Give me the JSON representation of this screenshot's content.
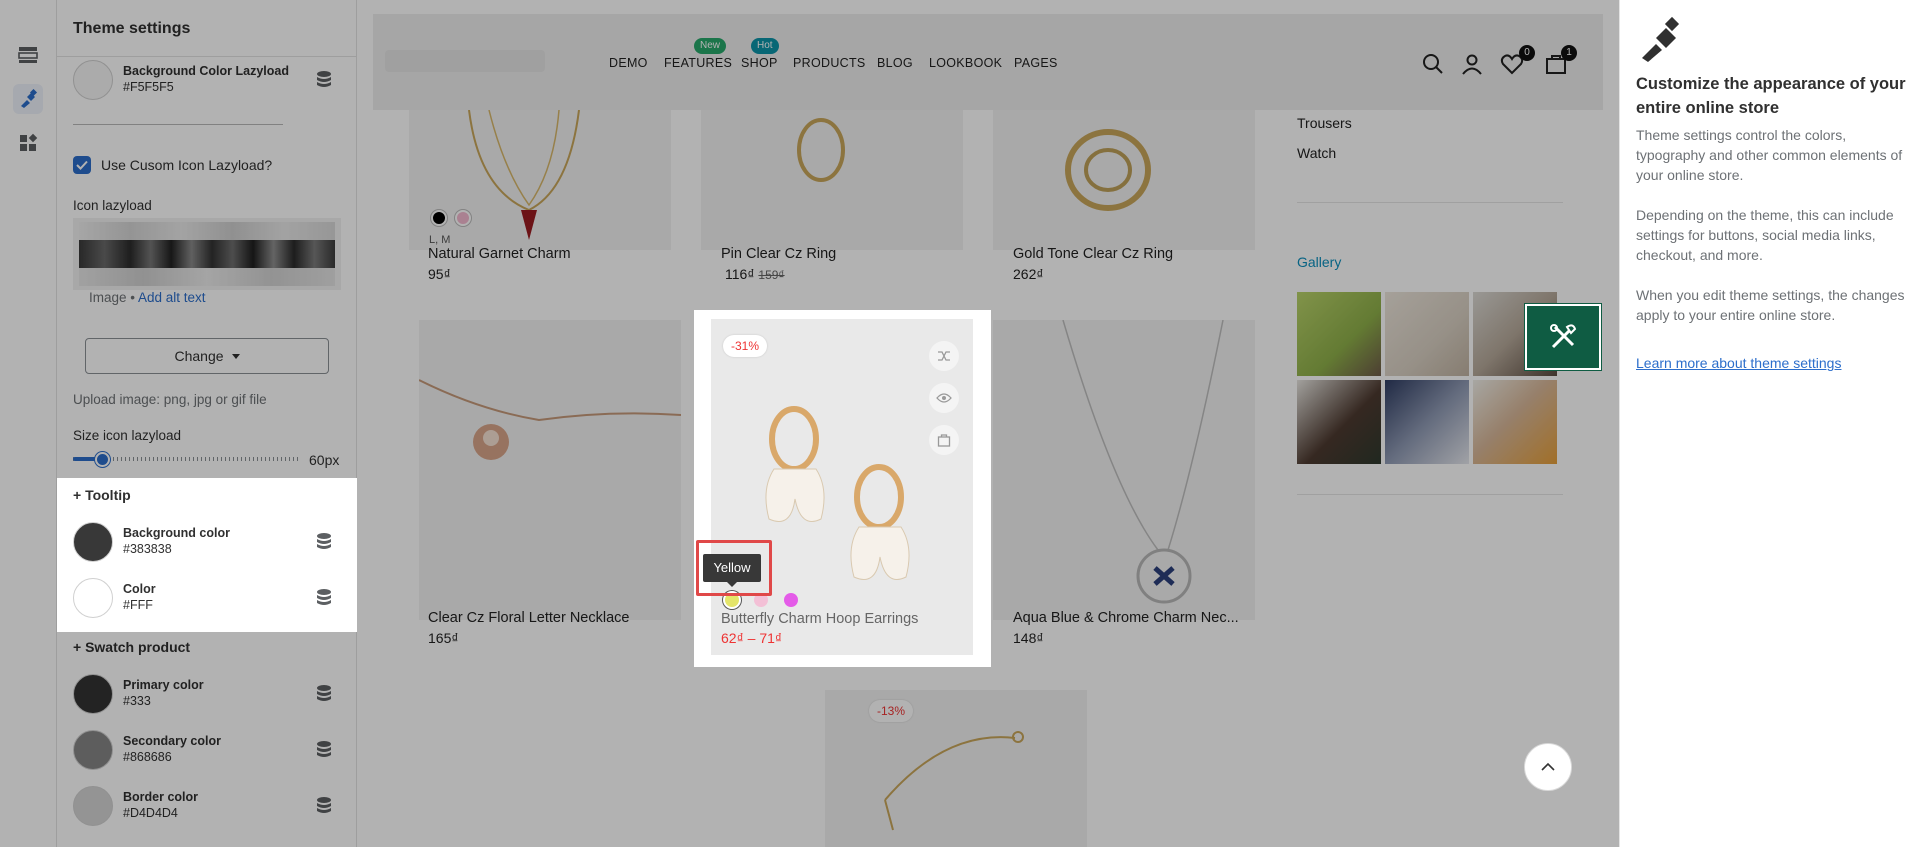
{
  "rail": {
    "items": [
      "sections",
      "theme-settings",
      "apps"
    ]
  },
  "panel": {
    "title": "Theme settings",
    "bg_lazyload": {
      "name": "Background Color Lazyload",
      "value": "#F5F5F5",
      "color": "#F5F5F5"
    },
    "checkbox_label": "Use Cusom Icon Lazyload?",
    "icon_label": "Icon lazyload",
    "image_caption": "Image",
    "alt_link": "Add alt text",
    "change_label": "Change",
    "upload_help": "Upload image: png, jpg or gif file",
    "size_label": "Size icon lazyload",
    "size_value": "60px",
    "size_percent": 8,
    "tooltip_section": "+ Tooltip",
    "tooltip_bg": {
      "name": "Background color",
      "value": "#383838",
      "color": "#383838"
    },
    "tooltip_color": {
      "name": "Color",
      "value": "#FFF",
      "color": "#FFFFFF"
    },
    "swatch_section": "+ Swatch product",
    "primary": {
      "name": "Primary color",
      "value": "#333",
      "color": "#333333"
    },
    "secondary": {
      "name": "Secondary color",
      "value": "#868686",
      "color": "#868686"
    },
    "border": {
      "name": "Border color",
      "value": "#D4D4D4",
      "color": "#D4D4D4"
    }
  },
  "store": {
    "nav": [
      "DEMO",
      "FEATURES",
      "SHOP",
      "PRODUCTS",
      "BLOG",
      "LOOKBOOK",
      "PAGES"
    ],
    "badge_new": "New",
    "badge_hot": "Hot",
    "wishlist_count": "0",
    "cart_count": "1",
    "products": [
      {
        "title": "Natural Garnet Charm",
        "price": "95₫",
        "sizes": "L, M"
      },
      {
        "title": "Pin Clear Cz Ring",
        "price": "116₫",
        "old_price": "159₫"
      },
      {
        "title": "Gold Tone Clear Cz Ring",
        "price": "262₫"
      },
      {
        "title": "Clear Cz Floral Letter Necklace",
        "price": "165₫"
      },
      {
        "title": "Butterfly Charm Hoop Earrings",
        "price": "62₫ – 71₫",
        "sale": "-31%"
      },
      {
        "title": "Aqua Blue & Chrome Charm Nec...",
        "price": "148₫"
      }
    ],
    "bottom_sale": "-13%",
    "sidebar_links": [
      "Trousers",
      "Watch"
    ],
    "gallery_title": "Gallery",
    "tooltip_text": "Yellow"
  },
  "info": {
    "title": "Customize the appearance of your entire online store",
    "p1": "Theme settings control the colors, typography and other common elements of your online store.",
    "p2": "Depending on the theme, this can include settings for buttons, social media links, checkout, and more.",
    "p3": "When you edit theme settings, the changes apply to your entire online store.",
    "link": "Learn more about theme settings"
  }
}
